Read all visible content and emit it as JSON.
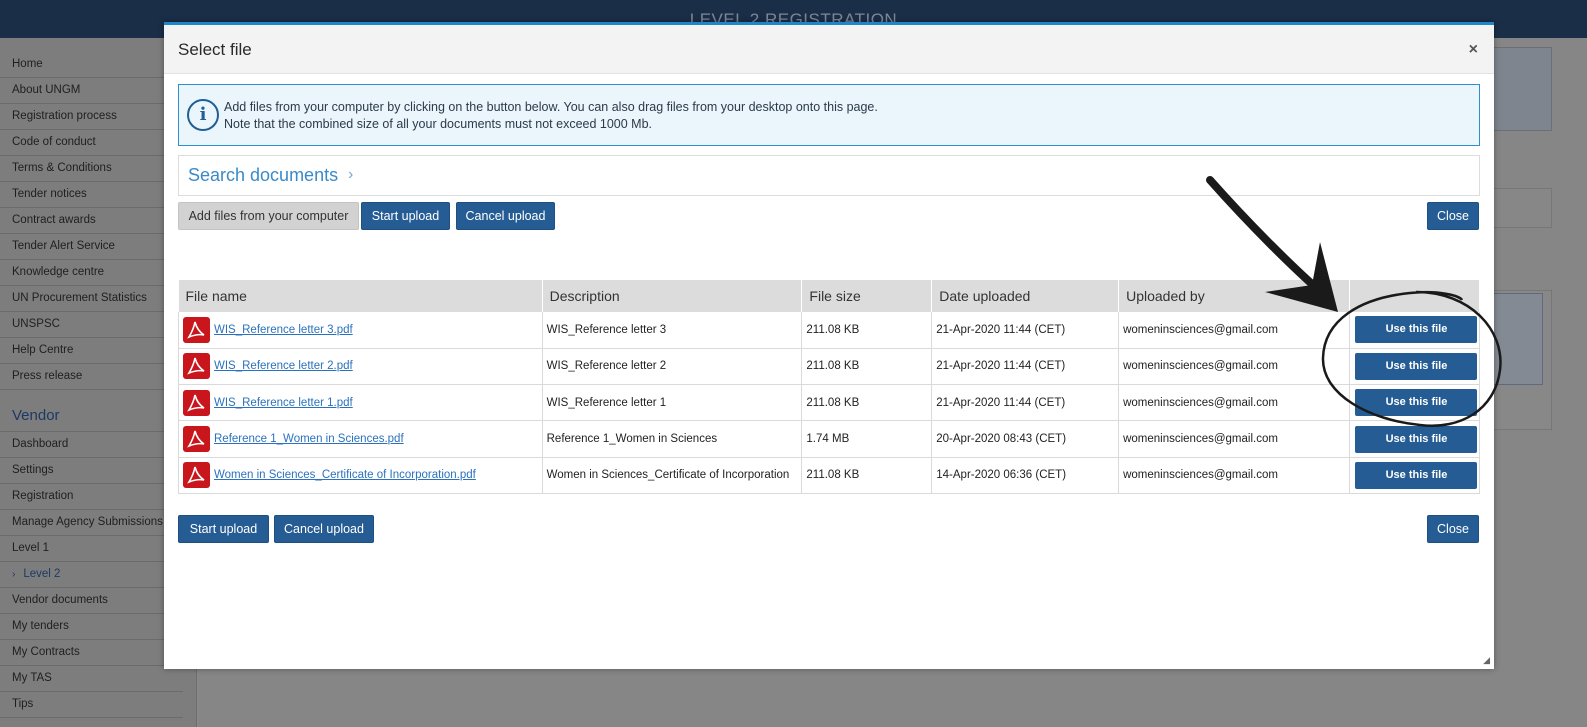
{
  "background": {
    "title": "LEVEL 2 REGISTRATION",
    "sidebar": {
      "items_top": [
        "Home",
        "About UNGM",
        "Registration process",
        "Code of conduct",
        "Terms & Conditions",
        "Tender notices",
        "Contract awards",
        "Tender Alert Service",
        "Knowledge centre",
        "UN Procurement Statistics",
        "UNSPSC",
        "Help Centre",
        "Press release"
      ],
      "section": "Vendor",
      "items_vendor": [
        "Dashboard",
        "Settings",
        "Registration",
        "Manage Agency Submissions",
        "Level 1",
        "Level 2",
        "Vendor documents",
        "My tenders",
        "My Contracts",
        "My TAS",
        "Tips"
      ],
      "active": "Level 2"
    }
  },
  "modal": {
    "title": "Select file",
    "close_symbol": "×",
    "info_line1": "Add files from your computer by clicking on the button below. You can also drag files from your desktop onto this page.",
    "info_line2": "Note that the combined size of all your documents must not exceed 1000 Mb.",
    "info_icon": "i",
    "search_label": "Search documents",
    "search_chevron": "›",
    "buttons": {
      "add_files": "Add files from your computer",
      "start_upload": "Start upload",
      "cancel_upload": "Cancel upload",
      "close": "Close"
    },
    "table": {
      "headers": [
        "File name",
        "Description",
        "File size",
        "Date uploaded",
        "Uploaded by",
        ""
      ],
      "use_label": "Use this file",
      "rows": [
        {
          "name": "WIS_Reference letter 3.pdf",
          "description": "WIS_Reference letter 3",
          "size": "211.08 KB",
          "date": "21-Apr-2020 11:44 (CET)",
          "by": "womeninsciences@gmail.com"
        },
        {
          "name": "WIS_Reference letter 2.pdf",
          "description": "WIS_Reference letter 2",
          "size": "211.08 KB",
          "date": "21-Apr-2020 11:44 (CET)",
          "by": "womeninsciences@gmail.com"
        },
        {
          "name": "WIS_Reference letter 1.pdf",
          "description": "WIS_Reference letter 1",
          "size": "211.08 KB",
          "date": "21-Apr-2020 11:44 (CET)",
          "by": "womeninsciences@gmail.com"
        },
        {
          "name": "Reference 1_Women in Sciences.pdf",
          "description": "Reference 1_Women in Sciences",
          "size": "1.74 MB",
          "date": "20-Apr-2020 08:43 (CET)",
          "by": "womeninsciences@gmail.com"
        },
        {
          "name": "Women in Sciences_Certificate of Incorporation.pdf",
          "description": "Women in Sciences_Certificate of Incorporation",
          "size": "211.08 KB",
          "date": "14-Apr-2020 06:36 (CET)",
          "by": "womeninsciences@gmail.com"
        }
      ]
    }
  },
  "colors": {
    "accent": "#255c93",
    "info_border": "#2d8ed0",
    "pdf_red": "#c9151c",
    "link": "#2a72bd"
  },
  "icons": [
    "info-icon",
    "pdf-icon",
    "close-icon",
    "chevron-right-icon",
    "resize-grip-icon"
  ]
}
